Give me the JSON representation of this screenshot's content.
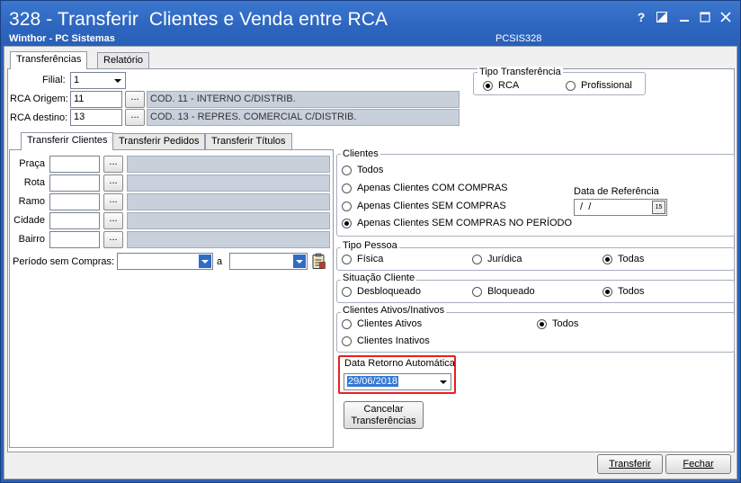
{
  "window": {
    "title": "328 - Transferir  Clientes e Venda entre RCA",
    "subtitle": "Winthor - PC Sistemas",
    "program_code": "PCSIS328",
    "controls": [
      "?",
      "restore",
      "minimize",
      "maximize",
      "close"
    ]
  },
  "main_tabs": [
    {
      "label": "Transferências",
      "active": true
    },
    {
      "label": "Relatório",
      "active": false
    }
  ],
  "header": {
    "filial_label": "Filial:",
    "filial_value": "1",
    "rca_origem_label": "RCA Origem:",
    "rca_origem_value": "11",
    "rca_origem_desc": "COD. 11 - INTERNO C/DISTRIB.",
    "rca_destino_label": "RCA destino:",
    "rca_destino_value": "13",
    "rca_destino_desc": "COD. 13 - REPRES. COMERCIAL C/DISTRIB.",
    "browse_label": "..."
  },
  "tipo_transferencia": {
    "title": "Tipo Transferência",
    "options": [
      {
        "label": "RCA",
        "selected": true
      },
      {
        "label": "Profissional",
        "selected": false
      }
    ]
  },
  "sub_tabs": [
    {
      "label": "Transferir Clientes",
      "active": true
    },
    {
      "label": "Transferir Pedidos",
      "active": false
    },
    {
      "label": "Transferir Títulos",
      "active": false
    }
  ],
  "filters": [
    {
      "label": "Praça"
    },
    {
      "label": "Rota"
    },
    {
      "label": "Ramo"
    },
    {
      "label": "Cidade"
    },
    {
      "label": "Bairro"
    }
  ],
  "periodo": {
    "label": "Período sem Compras:",
    "separator": "a"
  },
  "clientes": {
    "title": "Clientes",
    "options": [
      {
        "label": "Todos",
        "selected": false
      },
      {
        "label": "Apenas Clientes COM COMPRAS",
        "selected": false
      },
      {
        "label": "Apenas Clientes SEM COMPRAS",
        "selected": false
      },
      {
        "label": "Apenas Clientes SEM COMPRAS NO PERÍODO",
        "selected": true
      }
    ],
    "data_referencia_label": "Data de Referência",
    "data_referencia_value": " /  /",
    "calendar_day": "15"
  },
  "tipo_pessoa": {
    "title": "Tipo Pessoa",
    "options": [
      {
        "label": "Física",
        "selected": false
      },
      {
        "label": "Jurídica",
        "selected": false
      },
      {
        "label": "Todas",
        "selected": true
      }
    ]
  },
  "situacao_cliente": {
    "title": "Situação Cliente",
    "options": [
      {
        "label": "Desbloqueado",
        "selected": false
      },
      {
        "label": "Bloqueado",
        "selected": false
      },
      {
        "label": "Todos",
        "selected": true
      }
    ]
  },
  "clientes_ativos": {
    "title": "Clientes Ativos/Inativos",
    "options": [
      {
        "label": "Clientes Ativos",
        "selected": false
      },
      {
        "label": "Todos",
        "selected": true
      },
      {
        "label": "Clientes Inativos",
        "selected": false
      }
    ]
  },
  "data_retorno": {
    "title": "Data Retorno Automática",
    "value": "29/06/2018"
  },
  "buttons": {
    "cancelar_line1": "Cancelar",
    "cancelar_line2": "Transferências",
    "transferir": "Transferir",
    "fechar": "Fechar"
  },
  "colors": {
    "title_bar": "#2d66c0",
    "highlight": "#e8201e",
    "readonly_field": "#c8d0dc"
  }
}
